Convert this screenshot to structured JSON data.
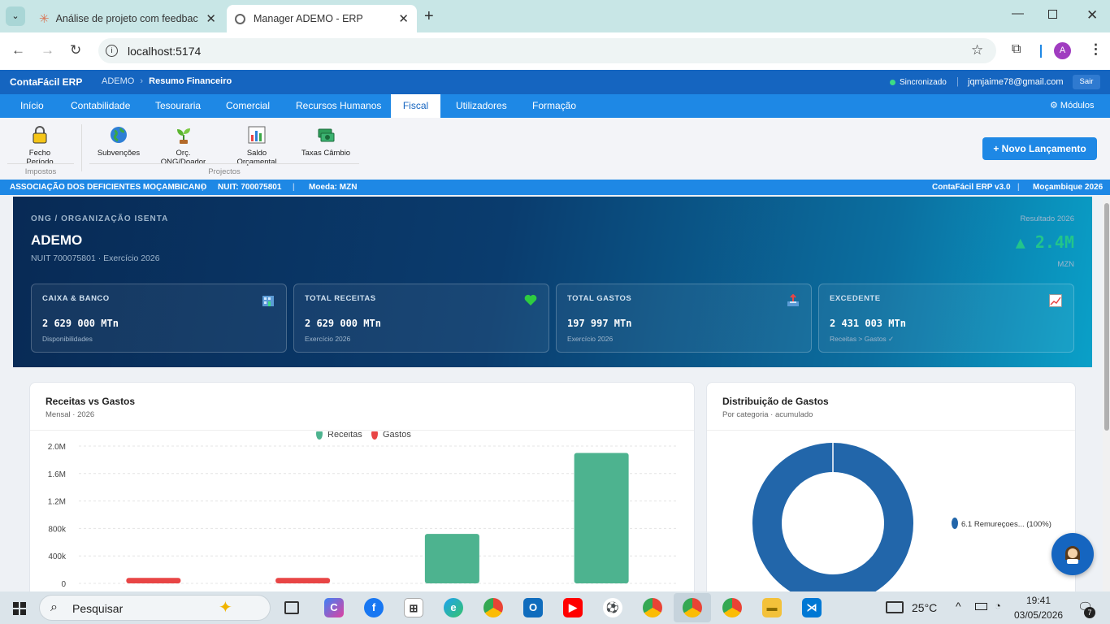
{
  "browser": {
    "tabs": [
      {
        "title": "Análise de projeto com feedbac",
        "icon": "claude-asterisk-icon"
      },
      {
        "title": "Manager ADEMO - ERP",
        "icon": "globe-icon"
      }
    ],
    "url": "localhost:5174",
    "profile_initial": "A"
  },
  "app": {
    "brand": "ContaFácil ERP",
    "breadcrumb_org": "ADEMO",
    "breadcrumb_page": "Resumo Financeiro",
    "sync_status": "Sincronizado",
    "user_email": "jqmjaime78@gmail.com",
    "logout_label": "Sair",
    "nav": [
      "Início",
      "Contabilidade",
      "Tesouraria",
      "Comercial",
      "Recursos Humanos",
      "Fiscal",
      "Utilizadores",
      "Formação"
    ],
    "nav_active": "Fiscal",
    "modules_label": "⚙ Módulos"
  },
  "ribbon": {
    "items": [
      {
        "label": "Fecho Período",
        "icon": "lock-icon"
      },
      {
        "label": "Subvenções",
        "icon": "globe-icon"
      },
      {
        "label": "Orç. ONG/Doador",
        "icon": "seedling-icon"
      },
      {
        "label": "Saldo Orçamental",
        "icon": "bar-chart-icon"
      },
      {
        "label": "Taxas Câmbio",
        "icon": "currency-exchange-icon"
      }
    ],
    "groups": [
      "Impostos",
      "Projectos"
    ],
    "new_entry_label": "+ Novo Lançamento"
  },
  "orgbar": {
    "name": "ASSOCIAÇÃO DOS DEFICIENTES MOÇAMBICANO",
    "nuit": "NUIT: 700075801",
    "currency": "Moeda: MZN",
    "version": "ContaFácil ERP v3.0",
    "country_year": "Moçambique 2026"
  },
  "hero": {
    "kicker": "ONG / ORGANIZAÇÃO ISENTA",
    "title": "ADEMO",
    "subtitle": "NUIT 700075801 · Exercício 2026",
    "result_label": "Resultado 2026",
    "result_value": "▲ 2.4M",
    "result_currency": "MZN",
    "result_color": "#22c58b",
    "kpis": [
      {
        "title": "CAIXA & BANCO",
        "value": "2 629 000 MTn",
        "sub": "Disponibilidades",
        "icon": "bank-building-icon"
      },
      {
        "title": "TOTAL RECEITAS",
        "value": "2 629 000 MTn",
        "sub": "Exercício 2026",
        "icon": "heart-icon"
      },
      {
        "title": "TOTAL GASTOS",
        "value": "197 997 MTn",
        "sub": "Exercício 2026",
        "icon": "outbox-tray-icon"
      },
      {
        "title": "EXCEDENTE",
        "value": "2 431 003 MTn",
        "sub": "Receitas > Gastos ✓",
        "icon": "trend-chart-icon"
      }
    ]
  },
  "charts": {
    "bar_card": {
      "title": "Receitas vs Gastos",
      "subtitle": "Mensal · 2026"
    },
    "pie_card": {
      "title": "Distribuição de Gastos",
      "subtitle": "Por categoria · acumulado"
    }
  },
  "chart_data": [
    {
      "type": "bar",
      "title": "Receitas vs Gastos",
      "subtitle": "Mensal · 2026",
      "categories": [
        "",
        "",
        "",
        ""
      ],
      "series": [
        {
          "name": "Receitas",
          "color": "#4db38f",
          "values": [
            0,
            0,
            720000,
            1900000
          ]
        },
        {
          "name": "Gastos",
          "color": "#e84545",
          "values": [
            80000,
            80000,
            0,
            0
          ]
        }
      ],
      "y_ticks": [
        "0",
        "400k",
        "800k",
        "1.2M",
        "1.6M",
        "2.0M"
      ],
      "ylim": [
        0,
        2000000
      ],
      "grid": true,
      "legend": "top-center"
    },
    {
      "type": "pie",
      "title": "Distribuição de Gastos",
      "subtitle": "Por categoria · acumulado",
      "slices": [
        {
          "label": "6.1 Remureçoes... (100%)",
          "value": 100,
          "color": "#2266aa"
        }
      ],
      "legend": "right"
    }
  ],
  "taskbar": {
    "search_placeholder": "Pesquisar",
    "weather": "25°C",
    "time": "19:41",
    "date": "03/05/2026",
    "notifications": "7"
  }
}
